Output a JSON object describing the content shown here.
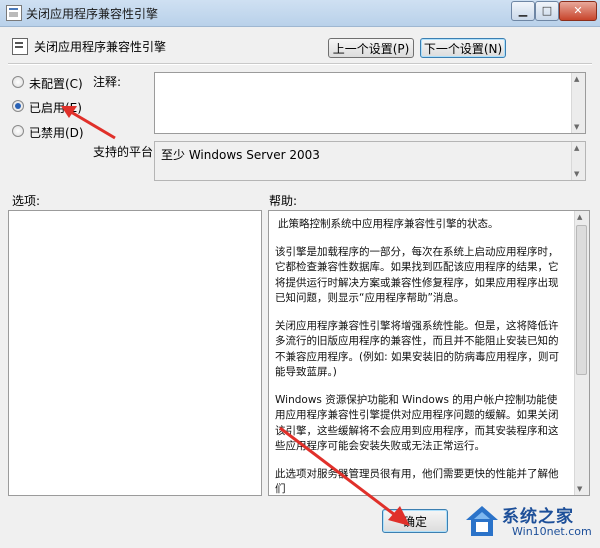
{
  "window": {
    "title": "关闭应用程序兼容性引擎",
    "minimize_glyph": "▁",
    "maximize_glyph": "□",
    "close_glyph": "✕"
  },
  "header": {
    "title": "关闭应用程序兼容性引擎",
    "prev_button": "上一个设置(P)",
    "next_button": "下一个设置(N)"
  },
  "radios": {
    "not_configured": {
      "label": "未配置(C)",
      "selected": false
    },
    "enabled": {
      "label": "已启用(E)",
      "selected": true
    },
    "disabled": {
      "label": "已禁用(D)",
      "selected": false
    }
  },
  "comment": {
    "label": "注释:",
    "value": ""
  },
  "supported": {
    "label": "支持的平台:",
    "value": "至少 Windows Server 2003"
  },
  "options": {
    "label": "选项:"
  },
  "help": {
    "label": "帮助:",
    "paragraphs": [
      "此策略控制系统中应用程序兼容性引擎的状态。",
      "该引擎是加载程序的一部分，每次在系统上启动应用程序时，它都检查兼容性数据库。如果找到匹配该应用程序的结果，它将提供运行时解决方案或兼容性修复程序，如果应用程序出现已知问题，则显示“应用程序帮助”消息。",
      "关闭应用程序兼容性引擎将增强系统性能。但是，这将降低许多流行的旧版应用程序的兼容性，而且并不能阻止安装已知的不兼容应用程序。(例如: 如果安装旧的防病毒应用程序，则可能导致蓝屏。)",
      "Windows 资源保护功能和 Windows 的用户帐户控制功能使用应用程序兼容性引擎提供对应用程序问题的缓解。如果关闭该引擎，这些缓解将不会应用到应用程序，而其安装程序和这些应用程序可能会安装失败或无法正常运行。",
      "此选项对服务器管理员很有用，他们需要更快的性能并了解他们"
    ]
  },
  "footer": {
    "ok_button": "确定"
  },
  "watermark": {
    "brand": "系统之家",
    "site": "Win10net.com"
  },
  "colors": {
    "arrow": "#e0302a",
    "accent": "#2a62b5"
  }
}
